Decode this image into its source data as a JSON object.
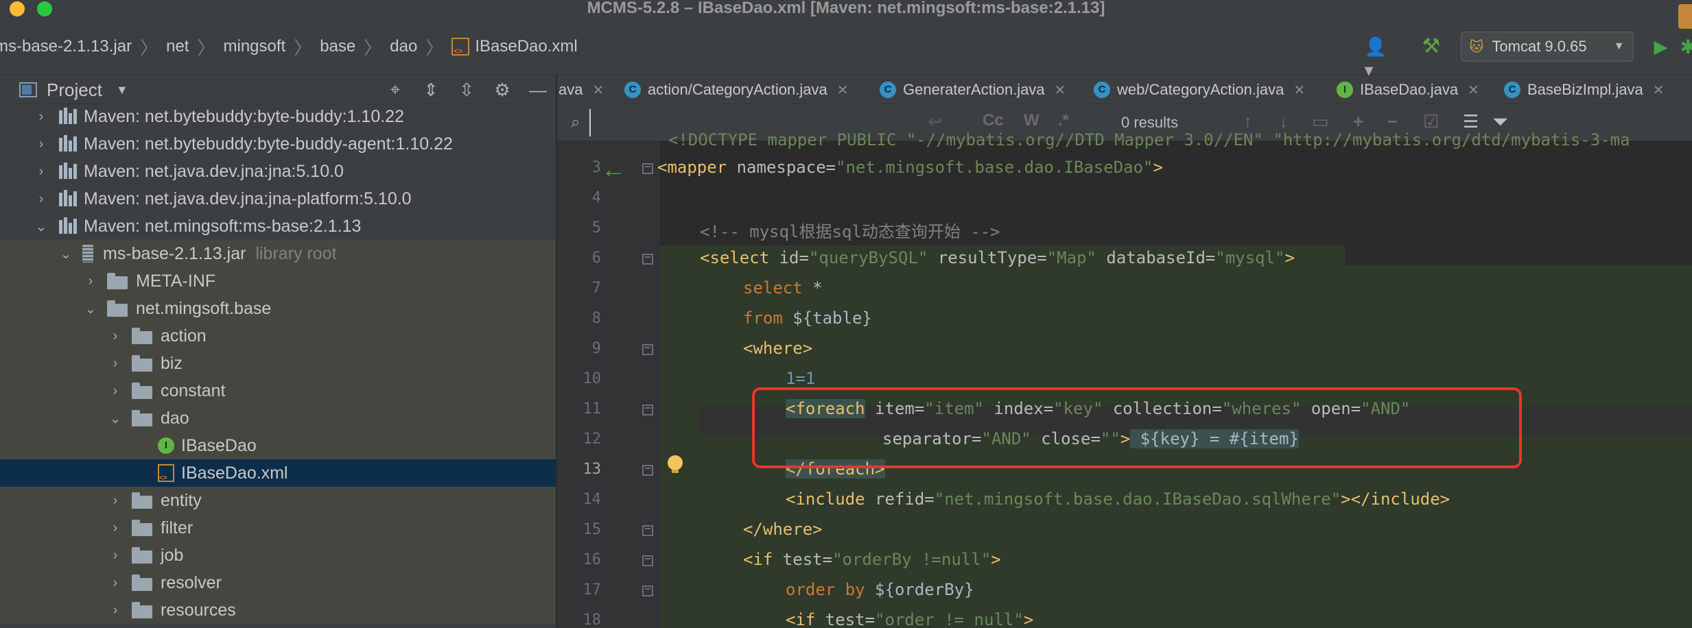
{
  "window": {
    "title": "MCMS-5.2.8 – IBaseDao.xml [Maven: net.mingsoft:ms-base:2.1.13]"
  },
  "breadcrumb": [
    "ms-base-2.1.13.jar",
    "net",
    "mingsoft",
    "base",
    "dao",
    "IBaseDao.xml"
  ],
  "toolbar": {
    "run_config": "Tomcat 9.0.65"
  },
  "project_panel": {
    "title": "Project",
    "tree": [
      {
        "label": "Maven: net.bytebuddy:byte-buddy:1.10.22",
        "suffix": ""
      },
      {
        "label": "Maven: net.bytebuddy:byte-buddy-agent:1.10.22",
        "suffix": ""
      },
      {
        "label": "Maven: net.java.dev.jna:jna:5.10.0",
        "suffix": ""
      },
      {
        "label": "Maven: net.java.dev.jna:jna-platform:5.10.0",
        "suffix": ""
      },
      {
        "label": "Maven: net.mingsoft:ms-base:2.1.13",
        "suffix": ""
      },
      {
        "label": "ms-base-2.1.13.jar",
        "suffix": "library root"
      },
      {
        "label": "META-INF",
        "suffix": ""
      },
      {
        "label": "net.mingsoft.base",
        "suffix": ""
      },
      {
        "label": "action",
        "suffix": ""
      },
      {
        "label": "biz",
        "suffix": ""
      },
      {
        "label": "constant",
        "suffix": ""
      },
      {
        "label": "dao",
        "suffix": ""
      },
      {
        "label": "IBaseDao",
        "suffix": ""
      },
      {
        "label": "IBaseDao.xml",
        "suffix": ""
      },
      {
        "label": "entity",
        "suffix": ""
      },
      {
        "label": "filter",
        "suffix": ""
      },
      {
        "label": "job",
        "suffix": ""
      },
      {
        "label": "resolver",
        "suffix": ""
      },
      {
        "label": "resources",
        "suffix": ""
      }
    ]
  },
  "tabs": [
    {
      "label": "ava"
    },
    {
      "label": "action/CategoryAction.java"
    },
    {
      "label": "GeneraterAction.java"
    },
    {
      "label": "web/CategoryAction.java"
    },
    {
      "label": "IBaseDao.java"
    },
    {
      "label": "BaseBizImpl.java"
    }
  ],
  "search": {
    "value": "",
    "results_text": "0 results",
    "toggles": [
      "Cc",
      "W",
      ".*"
    ]
  },
  "editor": {
    "line_numbers": [
      "3",
      "4",
      "5",
      "6",
      "7",
      "8",
      "9",
      "10",
      "11",
      "12",
      "13",
      "14",
      "15",
      "16",
      "17",
      "18"
    ],
    "current_line": "13",
    "top_partial_line": "<!DOCTYPE mapper PUBLIC \"-//mybatis.org//DTD Mapper 3.0//EN\" \"http://mybatis.org/dtd/mybatis-3-ma",
    "lines": {
      "l3": {
        "open": "<mapper",
        "attr": " namespace=",
        "val": "\"net.mingsoft.base.dao.IBaseDao\"",
        "close": ">"
      },
      "l5": {
        "comment": "<!-- mysql根据sql动态查询开始 -->"
      },
      "l6": {
        "open": "<select",
        "a1": " id=",
        "v1": "\"queryBySQL\"",
        "a2": " resultType=",
        "v2": "\"Map\"",
        "a3": " databaseId=",
        "v3": "\"mysql\"",
        "close": ">"
      },
      "l7": {
        "kw": "select",
        "rest": " *"
      },
      "l8": {
        "kw": "from",
        "rest": " ${table}"
      },
      "l9": {
        "tag": "<where>"
      },
      "l10": {
        "num": "1=1"
      },
      "l11": {
        "open": "<foreach",
        "a1": " item=",
        "v1": "\"item\"",
        "a2": " index=",
        "v2": "\"key\"",
        "a3": " collection=",
        "v3": "\"wheres\"",
        "a4": " open=",
        "v4": "\"AND\""
      },
      "l12": {
        "a1": "separator=",
        "v1": "\"AND\"",
        "a2": " close=",
        "v2": "\"\"",
        "close": ">",
        "rest": " ${key} = #{item}"
      },
      "l13": {
        "tag": "</foreach>"
      },
      "l14": {
        "open": "<include",
        "a1": " refid=",
        "v1": "\"net.mingsoft.base.dao.IBaseDao.sqlWhere\"",
        "close": "></include>"
      },
      "l15": {
        "tag": "</where>"
      },
      "l16": {
        "open": "<if",
        "a1": " test=",
        "v1": "\"orderBy !=null\"",
        "close": ">"
      },
      "l17": {
        "kw1": "order",
        "kw2": " by",
        "rest": " ${orderBy}"
      },
      "l18": {
        "open": "<if",
        "a1": " test=",
        "v1": "\"order != null\"",
        "close": ">"
      }
    }
  },
  "colors": {
    "tag": "#e8bf6a",
    "attr_value": "#6a8759",
    "sql_keyword": "#cc7832",
    "comment": "#808080",
    "highlight_box": "#e8362a"
  }
}
